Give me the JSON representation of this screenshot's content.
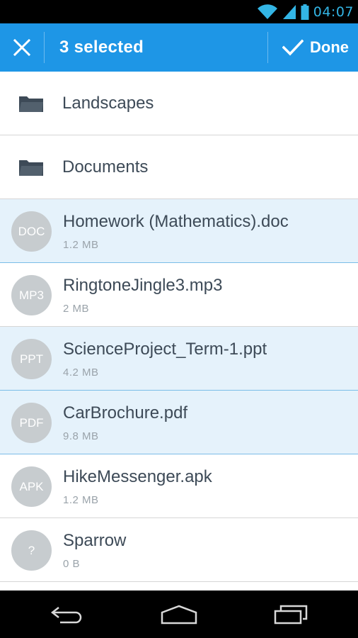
{
  "status_bar": {
    "time": "04:07",
    "icons": [
      "wifi-icon",
      "signal-icon",
      "battery-icon"
    ]
  },
  "action_bar": {
    "close_icon": "close-icon",
    "title": "3 selected",
    "done_label": "Done",
    "done_icon": "check-icon"
  },
  "folders": [
    {
      "label": "Landscapes",
      "icon": "folder-icon"
    },
    {
      "label": "Documents",
      "icon": "folder-icon"
    }
  ],
  "files": [
    {
      "badge": "DOC",
      "name": "Homework (Mathematics).doc",
      "size": "1.2 MB",
      "selected": true
    },
    {
      "badge": "MP3",
      "name": "RingtoneJingle3.mp3",
      "size": "2 MB",
      "selected": false
    },
    {
      "badge": "PPT",
      "name": "ScienceProject_Term-1.ppt",
      "size": "4.2 MB",
      "selected": true
    },
    {
      "badge": "PDF",
      "name": "CarBrochure.pdf",
      "size": "9.8 MB",
      "selected": true
    },
    {
      "badge": "APK",
      "name": "HikeMessenger.apk",
      "size": "1.2 MB",
      "selected": false
    },
    {
      "badge": "?",
      "name": "Sparrow",
      "size": "0 B",
      "selected": false
    }
  ],
  "nav_bar": {
    "icons": [
      "back-icon",
      "home-icon",
      "recents-icon"
    ]
  },
  "colors": {
    "accent": "#1e96e6",
    "selected_row": "#e5f2fb",
    "status_icons": "#33b5e5",
    "badge": "#c7cccf"
  }
}
